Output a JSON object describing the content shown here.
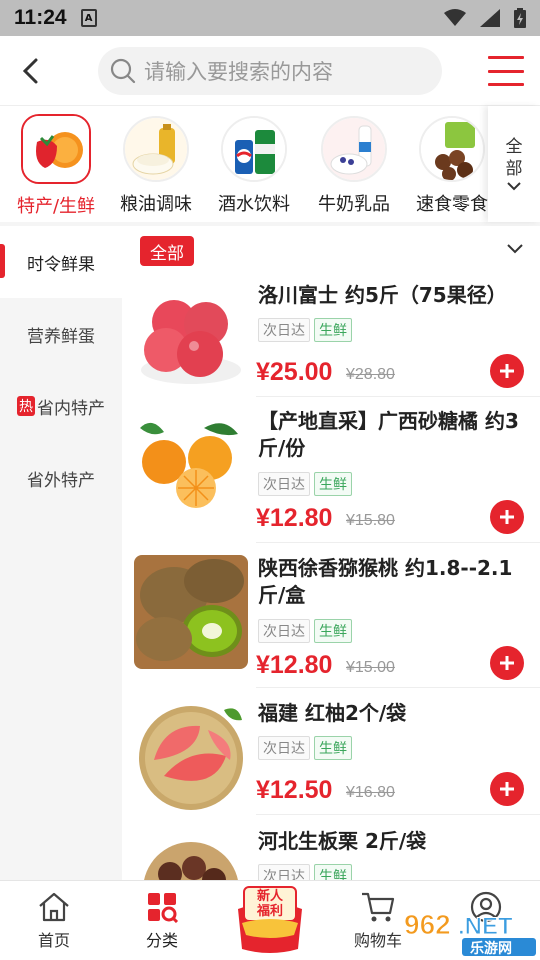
{
  "status_bar": {
    "time": "11:24",
    "indicator": "A"
  },
  "header": {
    "search_placeholder": "请输入要搜索的内容"
  },
  "categories": [
    {
      "label": "特产/生鲜",
      "active": true
    },
    {
      "label": "粮油调味",
      "active": false
    },
    {
      "label": "酒水饮料",
      "active": false
    },
    {
      "label": "牛奶乳品",
      "active": false
    },
    {
      "label": "速食零食",
      "active": false
    }
  ],
  "category_more": {
    "line1": "全",
    "line2": "部"
  },
  "side_nav": {
    "items": [
      {
        "label": "时令鲜果",
        "active": true
      },
      {
        "label": "营养鲜蛋",
        "active": false
      },
      {
        "label": "省内特产",
        "active": false,
        "badge": "热"
      },
      {
        "label": "省外特产",
        "active": false
      }
    ]
  },
  "filter": {
    "all_label": "全部"
  },
  "products": [
    {
      "name": "洛川富士 约5斤（75果径）",
      "tags": [
        "次日达",
        "生鲜"
      ],
      "price": "¥25.00",
      "old_price": "¥28.80"
    },
    {
      "name": "【产地直采】广西砂糖橘 约3斤/份",
      "tags": [
        "次日达",
        "生鲜"
      ],
      "price": "¥12.80",
      "old_price": "¥15.80"
    },
    {
      "name": "陕西徐香猕猴桃 约1.8--2.1斤/盒",
      "tags": [
        "次日达",
        "生鲜"
      ],
      "price": "¥12.80",
      "old_price": "¥15.00"
    },
    {
      "name": "福建 红柚2个/袋",
      "tags": [
        "次日达",
        "生鲜"
      ],
      "price": "¥12.50",
      "old_price": "¥16.80"
    },
    {
      "name": "河北生板栗 2斤/袋",
      "tags": [
        "次日达",
        "生鲜"
      ]
    }
  ],
  "bottom_nav": {
    "home": "首页",
    "category": "分类",
    "promo_line1": "新人",
    "promo_line2": "福利",
    "cart": "购物车",
    "mine": ""
  },
  "watermark": {
    "brand": "962.NET",
    "sub": "乐游网"
  },
  "colors": {
    "accent": "#e5242d",
    "fresh": "#3aa65b"
  }
}
